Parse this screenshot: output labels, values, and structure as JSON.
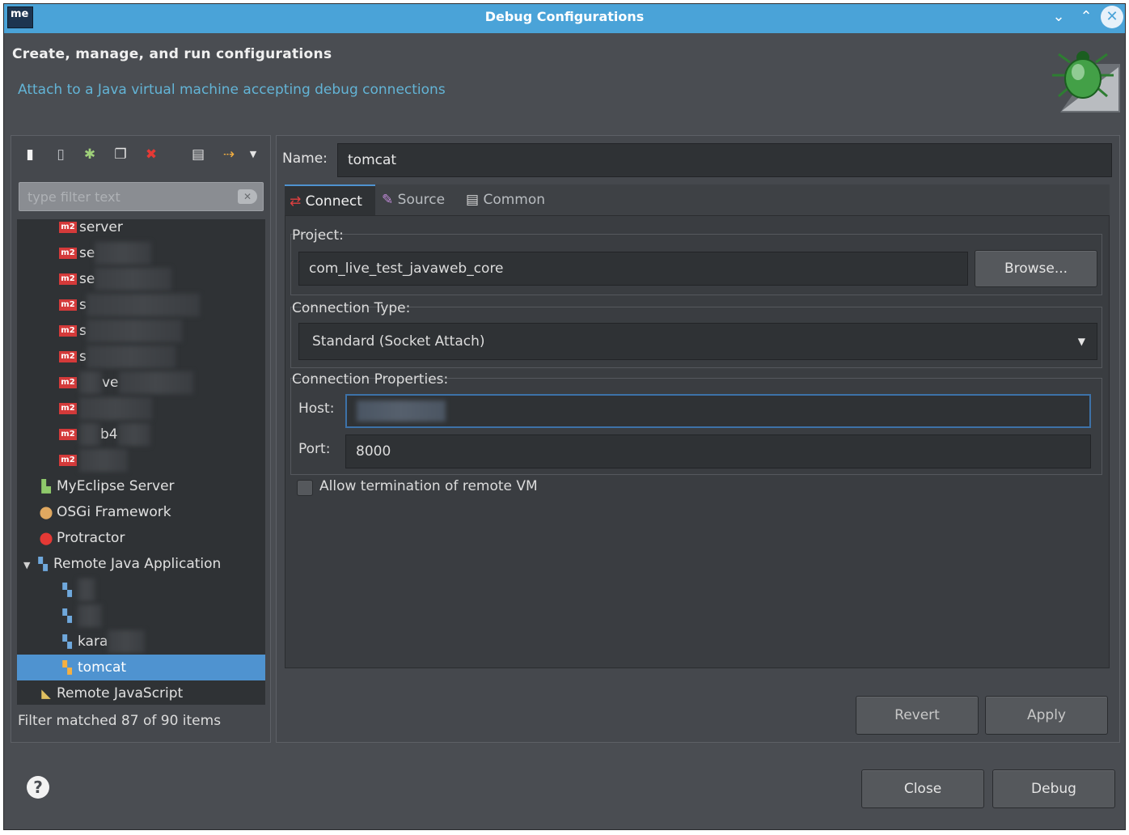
{
  "window": {
    "app_logo": "me",
    "title": "Debug Configurations",
    "minimize_glyph": "⌄",
    "maximize_glyph": "⌃",
    "close_glyph": "✕"
  },
  "header": {
    "title": "Create, manage, and run configurations",
    "subtitle": "Attach to a Java virtual machine accepting debug connections"
  },
  "left_toolbar": {
    "icons": [
      "new-config-icon",
      "new-prototype-icon",
      "export-icon",
      "duplicate-icon",
      "delete-icon",
      "collapse-all-icon",
      "filter-icon",
      "dropdown-icon"
    ]
  },
  "filter": {
    "placeholder": "type filter text",
    "status": "Filter matched 87 of 90 items"
  },
  "tree": {
    "m2_badge": "m2",
    "m2_items": [
      "server",
      "se",
      "se",
      "s",
      "s",
      "s",
      "ve",
      "",
      "b4",
      ""
    ],
    "categories": [
      {
        "label": "MyEclipse Server",
        "icon": "server-icon"
      },
      {
        "label": "OSGi Framework",
        "icon": "osgi-icon"
      },
      {
        "label": "Protractor",
        "icon": "protractor-icon"
      },
      {
        "label": "Remote Java Application",
        "icon": "remote-java-icon",
        "expanded": true
      }
    ],
    "remote_children": [
      "",
      "",
      "kara",
      "tomcat"
    ],
    "last_item": "Remote JavaScript",
    "selected": "tomcat"
  },
  "config": {
    "name_label": "Name:",
    "name_value": "tomcat",
    "tabs": [
      {
        "label": "Connect",
        "active": true
      },
      {
        "label": "Source",
        "active": false
      },
      {
        "label": "Common",
        "active": false
      }
    ],
    "project_label": "Project:",
    "project_value": "com_live_test_javaweb_core",
    "browse_label": "Browse...",
    "connection_type_label": "Connection Type:",
    "connection_type_value": "Standard (Socket Attach)",
    "connection_props_label": "Connection Properties:",
    "host_label": "Host:",
    "host_value": "",
    "port_label": "Port:",
    "port_value": "8000",
    "allow_termination_label": "Allow termination of remote VM",
    "allow_termination_checked": false
  },
  "buttons": {
    "revert": "Revert",
    "apply": "Apply",
    "close": "Close",
    "debug": "Debug",
    "help": "?"
  },
  "colors": {
    "titlebar": "#4aa3d8",
    "window_bg": "#4a4d52",
    "selection": "#4f93d0",
    "subtitle": "#63b4d6",
    "m2_badge": "#d43a3a"
  }
}
